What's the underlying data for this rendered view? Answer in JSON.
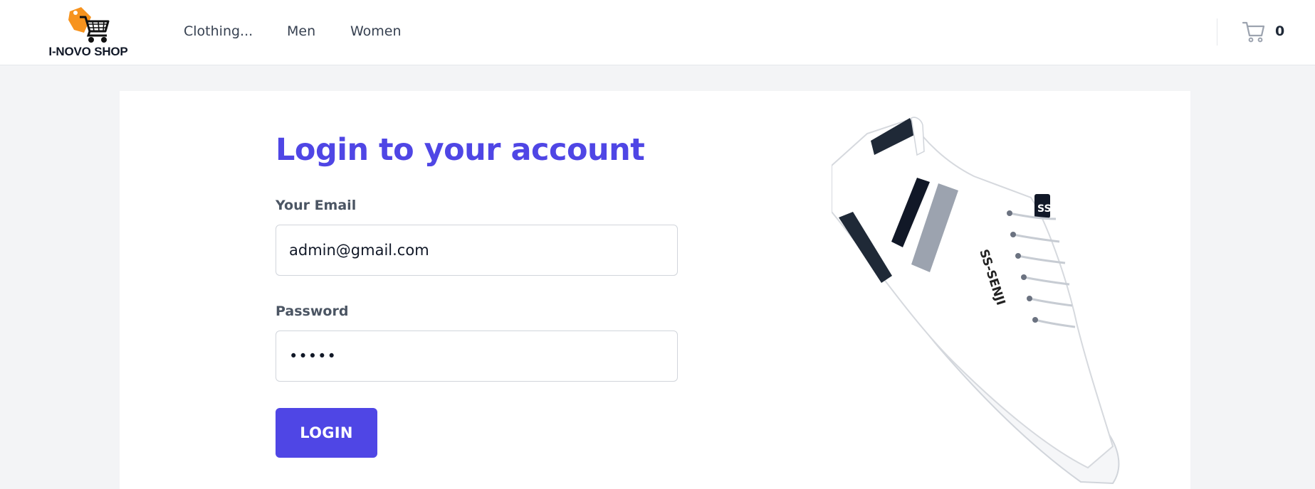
{
  "brand": {
    "name": "I-NOVO SHOP",
    "accent_color": "#4f46e5",
    "logo_color": "#f7931e"
  },
  "nav": {
    "items": [
      "Clothing...",
      "Men",
      "Women"
    ]
  },
  "cart": {
    "count": "0",
    "icon": "cart-icon"
  },
  "login": {
    "title": "Login to your account",
    "email_label": "Your Email",
    "email_value": "admin@gmail.com",
    "password_label": "Password",
    "password_value": "•••••",
    "button_label": "LOGIN"
  },
  "product_image": {
    "brand_text": "SS-SENJI",
    "badge_text": "SS"
  }
}
